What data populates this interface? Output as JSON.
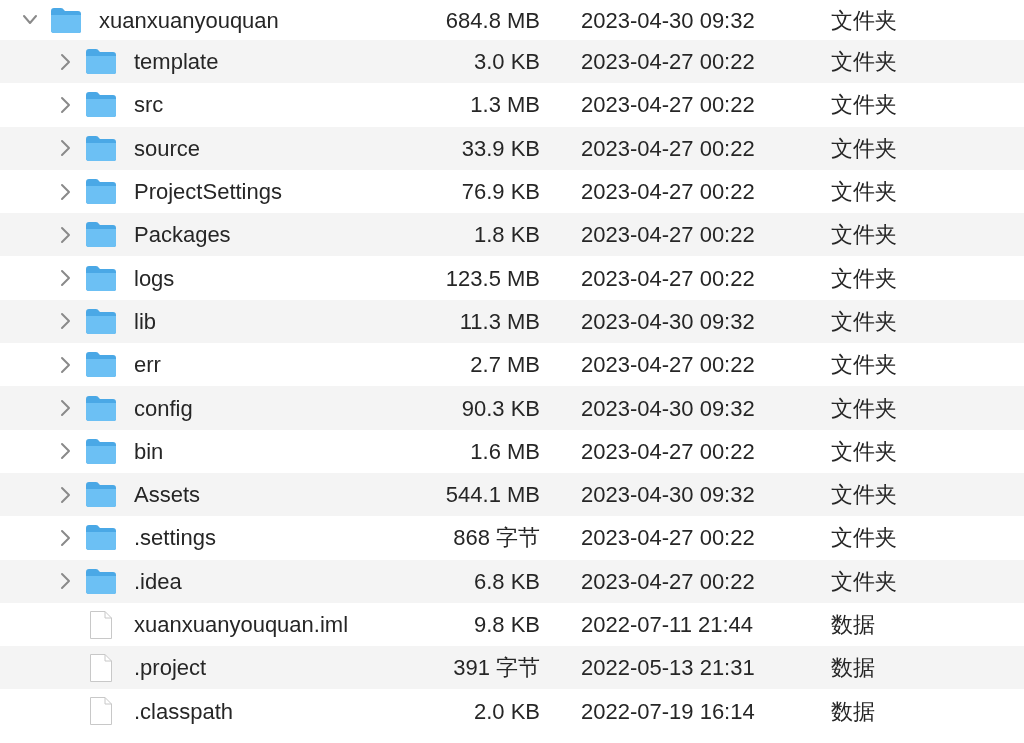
{
  "tree": [
    {
      "name": "xuanxuanyouquan",
      "size": "684.8 MB",
      "date": "2023-04-30 09:32",
      "type": "文件夹",
      "kind": "folder",
      "expanded": true,
      "children": [
        {
          "name": "template",
          "size": "3.0 KB",
          "date": "2023-04-27 00:22",
          "type": "文件夹",
          "kind": "folder",
          "expanded": false
        },
        {
          "name": "src",
          "size": "1.3 MB",
          "date": "2023-04-27 00:22",
          "type": "文件夹",
          "kind": "folder",
          "expanded": false
        },
        {
          "name": "source",
          "size": "33.9 KB",
          "date": "2023-04-27 00:22",
          "type": "文件夹",
          "kind": "folder",
          "expanded": false
        },
        {
          "name": "ProjectSettings",
          "size": "76.9 KB",
          "date": "2023-04-27 00:22",
          "type": "文件夹",
          "kind": "folder",
          "expanded": false
        },
        {
          "name": "Packages",
          "size": "1.8 KB",
          "date": "2023-04-27 00:22",
          "type": "文件夹",
          "kind": "folder",
          "expanded": false
        },
        {
          "name": "logs",
          "size": "123.5 MB",
          "date": "2023-04-27 00:22",
          "type": "文件夹",
          "kind": "folder",
          "expanded": false
        },
        {
          "name": "lib",
          "size": "11.3 MB",
          "date": "2023-04-30 09:32",
          "type": "文件夹",
          "kind": "folder",
          "expanded": false
        },
        {
          "name": "err",
          "size": "2.7 MB",
          "date": "2023-04-27 00:22",
          "type": "文件夹",
          "kind": "folder",
          "expanded": false
        },
        {
          "name": "config",
          "size": "90.3 KB",
          "date": "2023-04-30 09:32",
          "type": "文件夹",
          "kind": "folder",
          "expanded": false
        },
        {
          "name": "bin",
          "size": "1.6 MB",
          "date": "2023-04-27 00:22",
          "type": "文件夹",
          "kind": "folder",
          "expanded": false
        },
        {
          "name": "Assets",
          "size": "544.1 MB",
          "date": "2023-04-30 09:32",
          "type": "文件夹",
          "kind": "folder",
          "expanded": false
        },
        {
          "name": ".settings",
          "size": "868 字节",
          "date": "2023-04-27 00:22",
          "type": "文件夹",
          "kind": "folder",
          "expanded": false
        },
        {
          "name": ".idea",
          "size": "6.8 KB",
          "date": "2023-04-27 00:22",
          "type": "文件夹",
          "kind": "folder",
          "expanded": false
        },
        {
          "name": "xuanxuanyouquan.iml",
          "size": "9.8 KB",
          "date": "2022-07-11 21:44",
          "type": "数据",
          "kind": "file"
        },
        {
          "name": ".project",
          "size": "391 字节",
          "date": "2022-05-13 21:31",
          "type": "数据",
          "kind": "file"
        },
        {
          "name": ".classpath",
          "size": "2.0 KB",
          "date": "2022-07-19 16:14",
          "type": "数据",
          "kind": "file"
        }
      ]
    }
  ]
}
